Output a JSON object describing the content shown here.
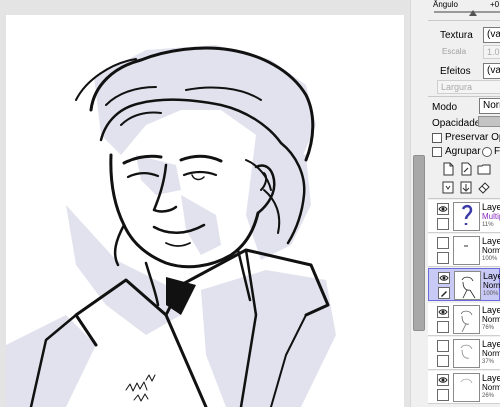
{
  "brush_panel": {
    "angle_label": "Ângulo",
    "angle_value": "+0",
    "texture_label": "Textura",
    "texture_value": "(va",
    "scale_label": "Escala",
    "scale_value": "1.0",
    "effects_label": "Efeitos",
    "effects_value": "(va",
    "width_label": "Largura"
  },
  "layer_panel": {
    "mode_label": "Modo",
    "mode_value": "Norm",
    "opacity_label": "Opacidade",
    "preserve_label": "Preservar Opac",
    "group_label": "Agrupar",
    "radio_label": "F",
    "layers": [
      {
        "name": "Laye",
        "mode": "Multip",
        "opacity": "11%",
        "mode_color": "#8a2bbd"
      },
      {
        "name": "Laye",
        "mode": "Norm",
        "opacity": "100%",
        "mode_color": "#000000"
      },
      {
        "name": "Laye",
        "mode": "Norm",
        "opacity": "100%",
        "mode_color": "#000000"
      },
      {
        "name": "Laye",
        "mode": "Norm",
        "opacity": "76%",
        "mode_color": "#000000"
      },
      {
        "name": "Laye",
        "mode": "Norm",
        "opacity": "37%",
        "mode_color": "#000000"
      },
      {
        "name": "Laye",
        "mode": "Norm",
        "opacity": "26%",
        "mode_color": "#000000"
      }
    ]
  },
  "colors": {
    "selected_layer": "#c9c9f5",
    "selected_border": "#6a6ad8",
    "shadow_fill": "#e2e2ee"
  }
}
